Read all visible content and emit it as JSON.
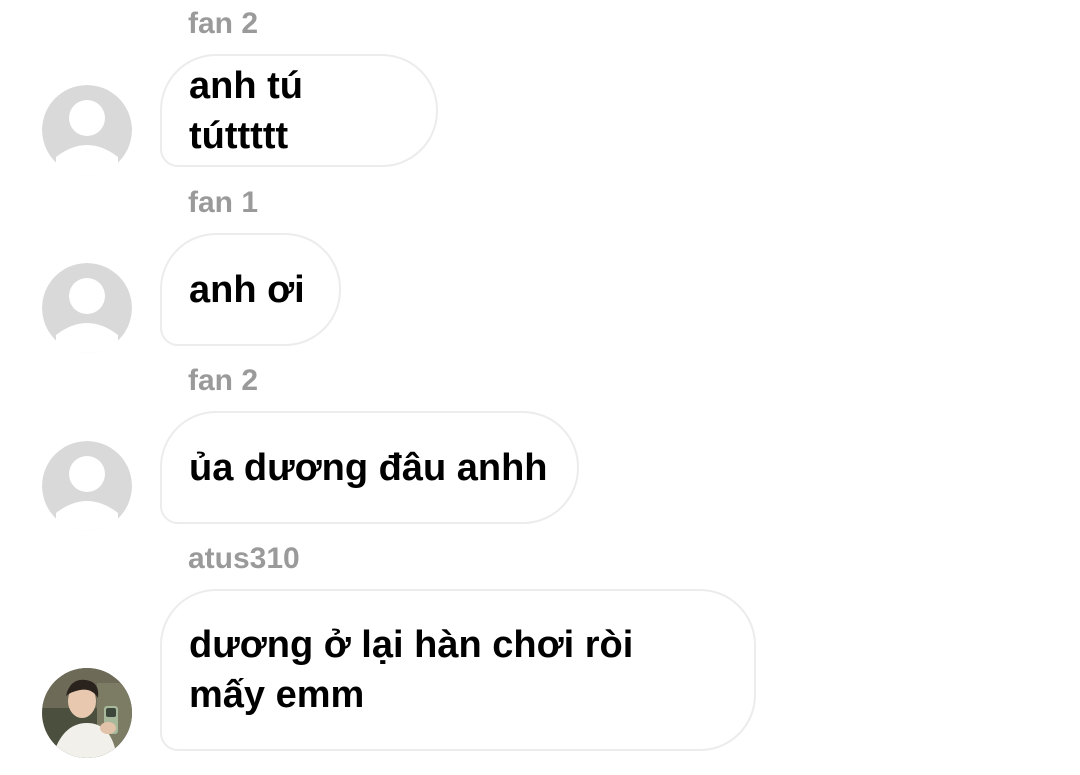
{
  "messages": [
    {
      "sender": "fan 2",
      "text": "anh tú túttttt",
      "avatar_icon": "default-avatar-icon"
    },
    {
      "sender": "fan 1",
      "text": "anh ơi",
      "avatar_icon": "default-avatar-icon"
    },
    {
      "sender": "fan 2",
      "text": "ủa dương đâu anhh",
      "avatar_icon": "default-avatar-icon"
    },
    {
      "sender": "atus310",
      "text": "dương ở lại hàn chơi ròi mấy emm",
      "avatar_icon": "profile-photo"
    }
  ],
  "colors": {
    "sender_label": "#9a9a9a",
    "bubble_border": "#ececec",
    "default_avatar_bg": "#d9d9d9",
    "message_text": "#000000"
  }
}
